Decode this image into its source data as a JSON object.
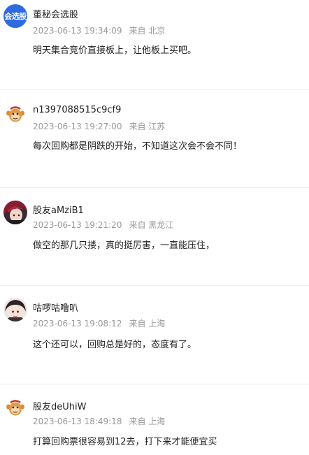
{
  "comments": [
    {
      "username": "董秘会选股",
      "avatar_text": "会选股",
      "timestamp": "2023-06-13 19:34:09",
      "location": "来自 北京",
      "content": "明天集合竞价直接板上，让他板上买吧。"
    },
    {
      "username": "n1397088515c9cf9",
      "timestamp": "2023-06-13 19:27:00",
      "location": "来自 江苏",
      "content": "每次回购都是阴跌的开始，不知道这次会不会不同！"
    },
    {
      "username": "股友aMziB1",
      "timestamp": "2023-06-13 19:21:20",
      "location": "来自 黑龙江",
      "content": "做空的那几只搂，真的挺厉害，一直能压住，"
    },
    {
      "username": "咕啰咕噜叭",
      "timestamp": "2023-06-13 19:08:12",
      "location": "来自 上海",
      "content": "这个还可以，回购总是好的，态度有了。"
    },
    {
      "username": "股友deUhiW",
      "timestamp": "2023-06-13 18:49:18",
      "location": "来自 上海",
      "content": "打算回购票很容易到12去，打下来才能便宜买"
    }
  ],
  "colors": {
    "brand_avatar": "#2f6be0",
    "meta_text": "#999999",
    "divider": "#ededed"
  }
}
